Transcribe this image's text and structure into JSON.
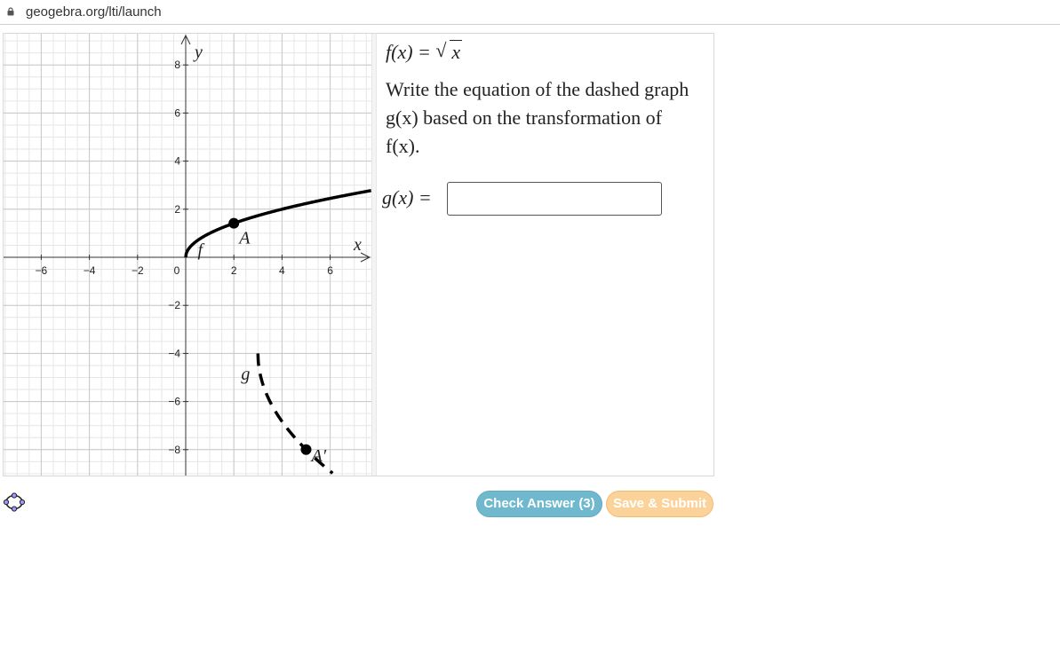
{
  "browser": {
    "url": "geogebra.org/lti/launch"
  },
  "graph": {
    "axis_x_label": "x",
    "axis_y_label": "y",
    "x_ticks": [
      "−6",
      "−4",
      "−2",
      "0",
      "2",
      "4",
      "6"
    ],
    "y_ticks": [
      "8",
      "6",
      "4",
      "2",
      "−2",
      "−4",
      "−6",
      "−8"
    ],
    "curve_f_label": "f",
    "curve_g_label": "g",
    "point_a_label": "A",
    "point_a_prime_label": "A′",
    "point_a": [
      2,
      1.414
    ],
    "point_a_prime": [
      5,
      -8
    ]
  },
  "algebra": {
    "f_lhs": "f(x) =",
    "f_rad_symbol": "√",
    "f_radicand": "x",
    "prompt": "Write the equation of the dashed graph g(x) based on the transformation of f(x).",
    "g_lhs": "g(x) =",
    "answer_value": ""
  },
  "buttons": {
    "check_label": "Check Answer (3)",
    "save_label": "Save & Submit"
  },
  "colors": {
    "check": "#6fb8ce",
    "save": "#fbd39a",
    "curve": "#000000"
  },
  "icons": {
    "lock": "lock-icon",
    "logo": "geogebra-logo-icon"
  }
}
